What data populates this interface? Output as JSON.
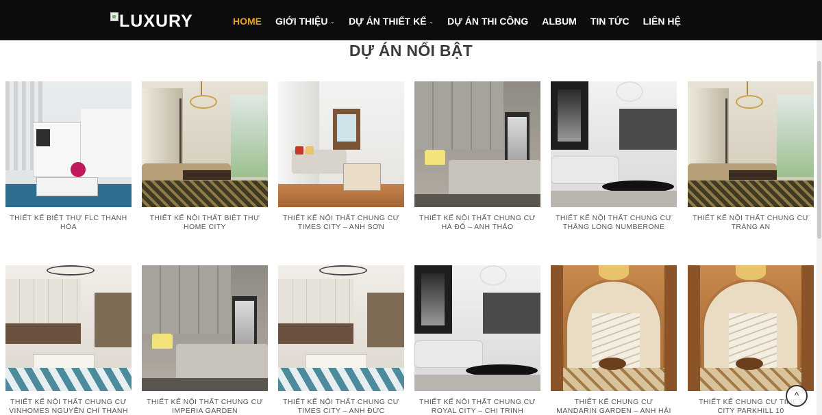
{
  "header": {
    "logo_text": "LUXURY",
    "nav": [
      {
        "label": "HOME",
        "active": true,
        "dropdown": false
      },
      {
        "label": "GIỚI THIỆU",
        "active": false,
        "dropdown": true
      },
      {
        "label": "DỰ ÁN THIẾT KẾ",
        "active": false,
        "dropdown": true
      },
      {
        "label": "DỰ ÁN THI CÔNG",
        "active": false,
        "dropdown": false
      },
      {
        "label": "ALBUM",
        "active": false,
        "dropdown": false
      },
      {
        "label": "TIN TỨC",
        "active": false,
        "dropdown": false
      },
      {
        "label": "LIÊN HỆ",
        "active": false,
        "dropdown": false
      }
    ],
    "chevron": "⌄"
  },
  "section": {
    "title": "DỰ ÁN NỔI BẬT"
  },
  "projects": [
    {
      "caption": "THIẾT KẾ BIỆT THỰ FLC THANH HÓA",
      "style": "white-living"
    },
    {
      "caption": "THIẾT KẾ NỘI THẤT BIỆT THỰ HOME CITY",
      "style": "classic-chandelier"
    },
    {
      "caption": "THIẾT KẾ NỘI THẤT CHUNG CƯ TIMES CITY – ANH SƠN",
      "style": "wood-corridor"
    },
    {
      "caption": "THIẾT KẾ NỘI THẤT CHUNG CƯ HÀ ĐÔ – ANH THẢO",
      "style": "grey-bedroom"
    },
    {
      "caption": "THIẾT KẾ NỘI THẤT CHUNG CƯ THĂNG LONG NUMBERONE",
      "style": "modern-dining"
    },
    {
      "caption": "THIẾT KẾ NỘI THẤT CHUNG CƯ TRÀNG AN",
      "style": "classic-chandelier"
    },
    {
      "caption": "THIẾT KẾ NỘI THẤT CHUNG CƯ VINHOMES NGUYỄN CHÍ THANH",
      "style": "kitchen-living"
    },
    {
      "caption": "THIẾT KẾ NỘI THẤT CHUNG CƯ IMPERIA GARDEN",
      "style": "grey-bedroom"
    },
    {
      "caption": "THIẾT KẾ NỘI THẤT CHUNG CƯ TIMES CITY – ANH ĐỨC",
      "style": "kitchen-living"
    },
    {
      "caption": "THIẾT KẾ NỘI THẤT CHUNG CƯ ROYAL CITY – CHỊ TRINH",
      "style": "modern-dining"
    },
    {
      "caption": "THIẾT KẾ CHUNG CƯ MANDARIN GARDEN – ANH HẢI",
      "style": "royal-hall"
    },
    {
      "caption": "THIẾT KẾ CHUNG CƯ TIMES CITY PARKHILL 10",
      "style": "royal-hall"
    }
  ],
  "scroll_top_icon": "^"
}
